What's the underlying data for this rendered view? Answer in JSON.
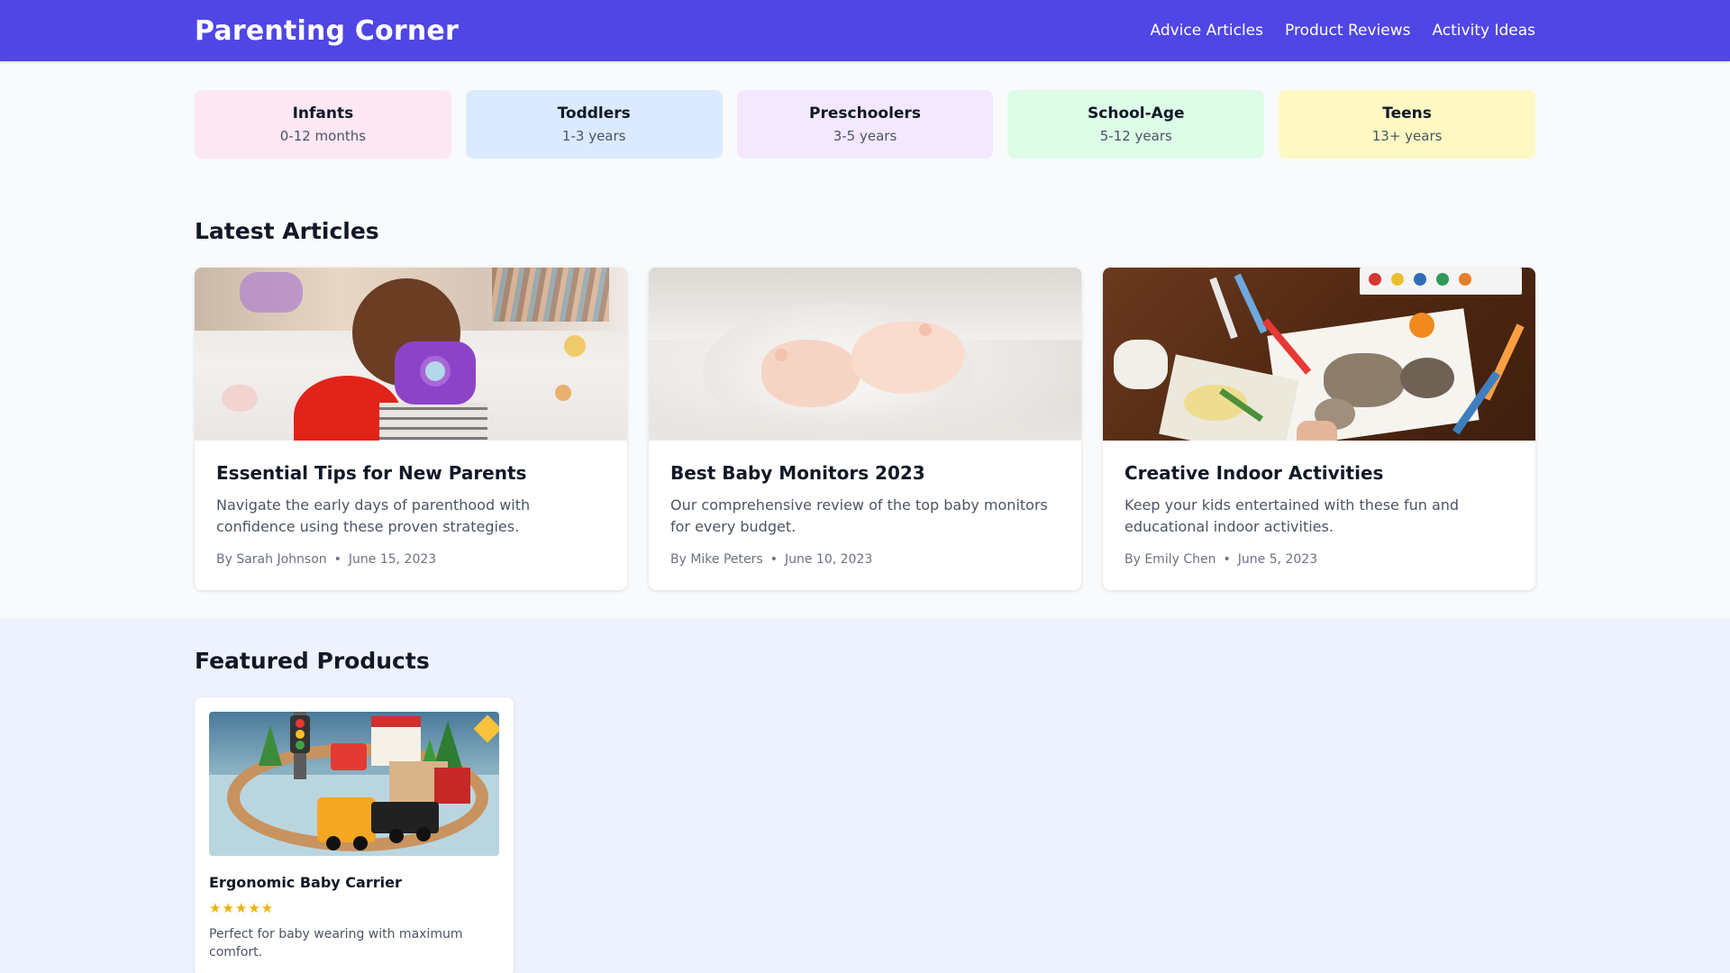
{
  "header": {
    "brand": "Parenting Corner",
    "nav": [
      "Advice Articles",
      "Product Reviews",
      "Activity Ideas"
    ]
  },
  "age_groups": [
    {
      "title": "Infants",
      "range": "0-12 months",
      "color": "#fce7f3"
    },
    {
      "title": "Toddlers",
      "range": "1-3 years",
      "color": "#dbeafe"
    },
    {
      "title": "Preschoolers",
      "range": "3-5 years",
      "color": "#f3e8ff"
    },
    {
      "title": "School-Age",
      "range": "5-12 years",
      "color": "#dcfce7"
    },
    {
      "title": "Teens",
      "range": "13+ years",
      "color": "#fef9c3"
    }
  ],
  "articles_section": {
    "title": "Latest Articles",
    "items": [
      {
        "title": "Essential Tips for New Parents",
        "excerpt": "Navigate the early days of parenthood with confidence using these proven strategies.",
        "author": "By Sarah Johnson",
        "date": "June 15, 2023"
      },
      {
        "title": "Best Baby Monitors 2023",
        "excerpt": "Our comprehensive review of the top baby monitors for every budget.",
        "author": "By Mike Peters",
        "date": "June 10, 2023"
      },
      {
        "title": "Creative Indoor Activities",
        "excerpt": "Keep your kids entertained with these fun and educational indoor activities.",
        "author": "By Emily Chen",
        "date": "June 5, 2023"
      }
    ],
    "separator": "•"
  },
  "products_section": {
    "title": "Featured Products",
    "items": [
      {
        "name": "Ergonomic Baby Carrier",
        "stars": "★★★★★",
        "description": "Perfect for baby wearing with maximum comfort."
      }
    ]
  },
  "colors": {
    "brand": "#4f46e5",
    "featured_bg": "#eef2ff",
    "star": "#eab308"
  }
}
